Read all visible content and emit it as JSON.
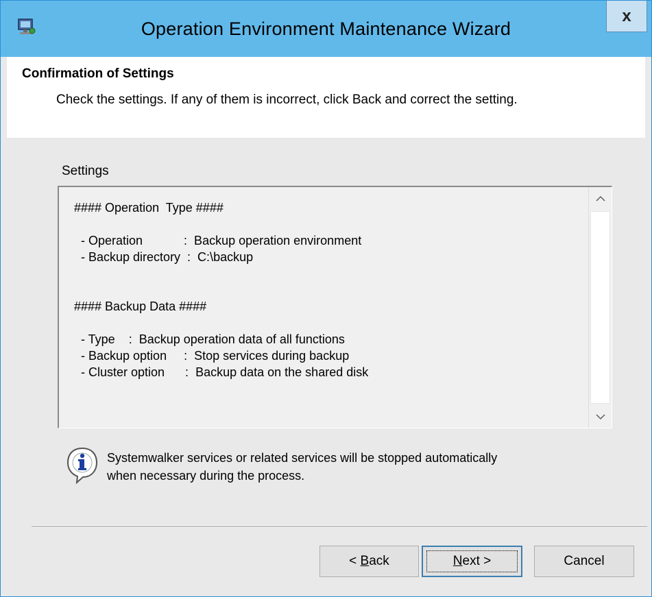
{
  "window": {
    "title": "Operation Environment Maintenance Wizard",
    "close_label": "x",
    "app_icon": "computer-monitor-icon"
  },
  "header": {
    "title": "Confirmation of Settings",
    "description": "Check the settings. If any of them is incorrect, click Back and correct the setting."
  },
  "settings": {
    "label": "Settings",
    "lines": [
      "#### Operation  Type ####",
      "",
      "  - Operation            :  Backup operation environment",
      "  - Backup directory  :  C:\\backup",
      "",
      "",
      "#### Backup Data ####",
      "",
      "  - Type    :  Backup operation data of all functions",
      "  - Backup option     :  Stop services during backup",
      "  - Cluster option      :  Backup data on the shared disk"
    ]
  },
  "info": {
    "icon": "information-icon",
    "line1": "Systemwalker services or related services will be stopped automatically",
    "line2": "when necessary during the process."
  },
  "buttons": {
    "back_prefix": "< ",
    "back_mnemonic": "B",
    "back_rest": "ack",
    "next_mnemonic": "N",
    "next_rest": "ext >",
    "cancel": "Cancel"
  },
  "colors": {
    "titlebar": "#61b9ea",
    "window_border": "#2b8fd6",
    "body_bg": "#e9e9e9",
    "info_icon_blue": "#1a3fa0"
  }
}
